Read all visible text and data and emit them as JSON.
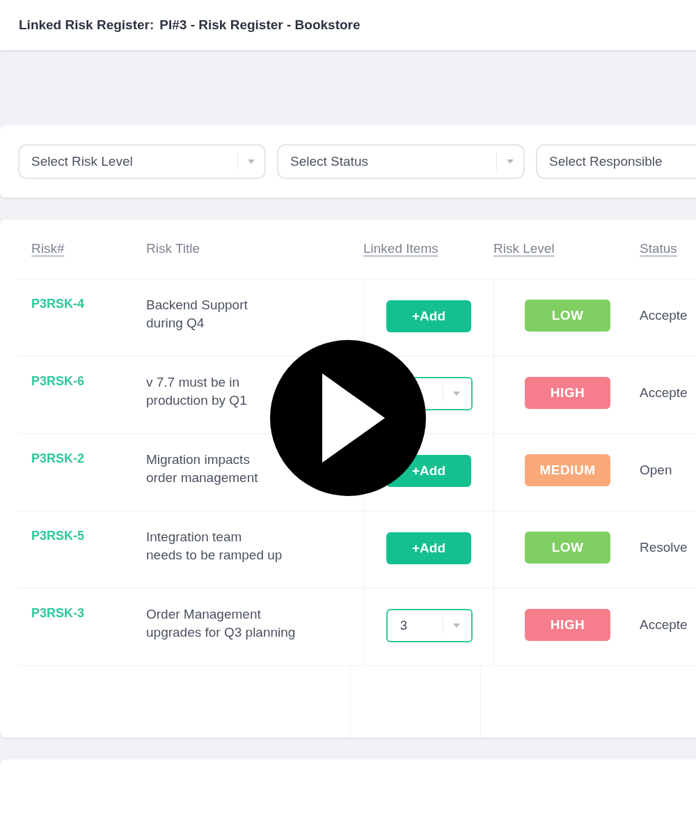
{
  "header": {
    "label": "Linked Risk Register:",
    "value": "PI#3 - Risk Register - Bookstore"
  },
  "filters": [
    {
      "placeholder": "Select Risk Level",
      "has_caret": true
    },
    {
      "placeholder": "Select Status",
      "has_caret": true
    },
    {
      "placeholder": "Select Responsible",
      "has_caret": false
    }
  ],
  "table": {
    "columns": [
      {
        "label": "Risk#",
        "sortable": true
      },
      {
        "label": "Risk Title",
        "sortable": false
      },
      {
        "label": "Linked Items",
        "sortable": true
      },
      {
        "label": "Risk Level",
        "sortable": true
      },
      {
        "label": "Status",
        "sortable": true
      }
    ],
    "rows": [
      {
        "id": "P3RSK-4",
        "title": [
          "Backend Support",
          "during Q4"
        ],
        "linked": {
          "kind": "add",
          "label": "+Add"
        },
        "risk_level": {
          "label": "LOW",
          "color": "#7fcf63"
        },
        "status": "Accepte"
      },
      {
        "id": "P3RSK-6",
        "title": [
          "v 7.7 must be in",
          "production by Q1"
        ],
        "linked": {
          "kind": "select"
        },
        "risk_level": {
          "label": "HIGH",
          "color": "#f67d8c"
        },
        "status": "Accepte"
      },
      {
        "id": "P3RSK-2",
        "title": [
          "Migration impacts",
          "order management"
        ],
        "linked": {
          "kind": "add",
          "label": "+Add"
        },
        "risk_level": {
          "label": "MEDIUM",
          "color": "#f9a979"
        },
        "status": "Open"
      },
      {
        "id": "P3RSK-5",
        "title": [
          "Integration team",
          "needs to be ramped up"
        ],
        "linked": {
          "kind": "add",
          "label": "+Add"
        },
        "risk_level": {
          "label": "LOW",
          "color": "#7fcf63"
        },
        "status": "Resolve"
      },
      {
        "id": "P3RSK-3",
        "title": [
          "Order Management",
          "upgrades for Q3 planning"
        ],
        "linked": {
          "kind": "select",
          "value": "3"
        },
        "risk_level": {
          "label": "HIGH",
          "color": "#f67d8c"
        },
        "status": "Accepte"
      }
    ]
  },
  "video_overlay": {
    "play_button": true
  }
}
